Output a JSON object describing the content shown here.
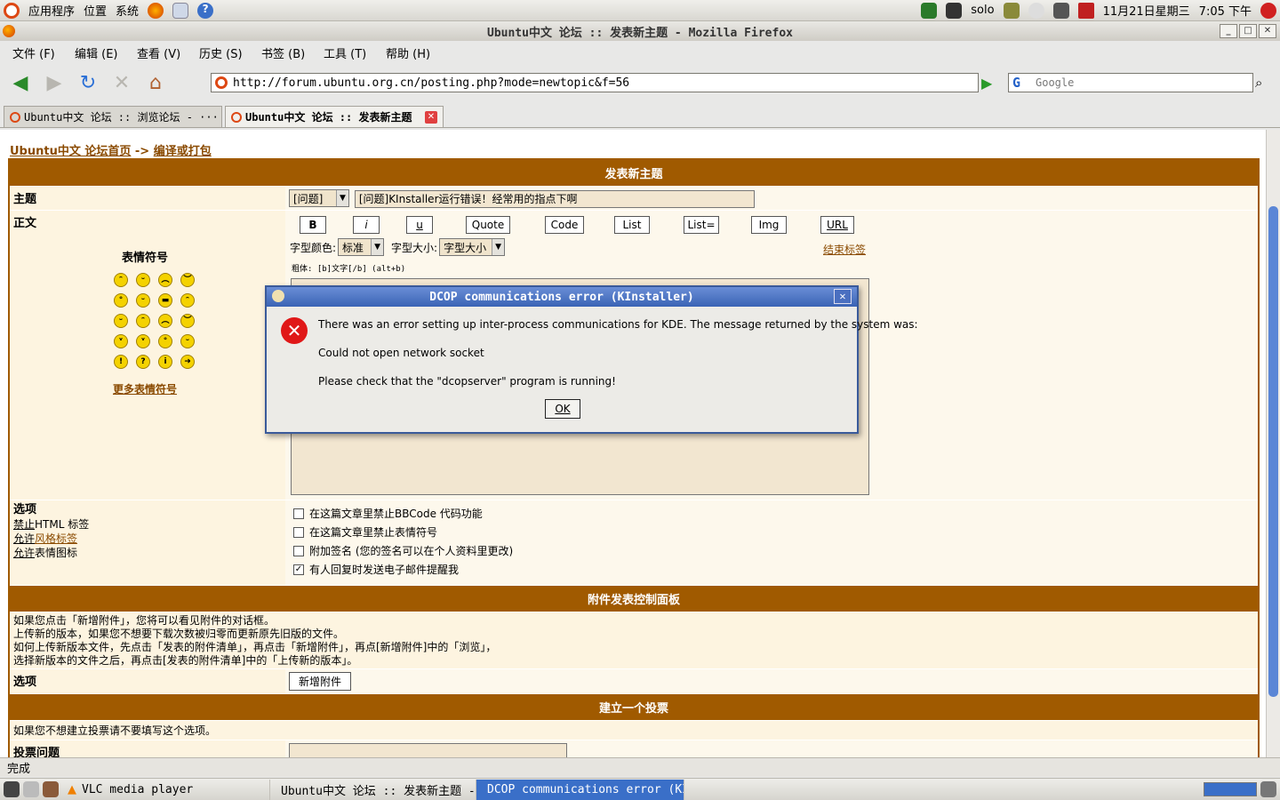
{
  "top_panel": {
    "menus": [
      "应用程序",
      "位置",
      "系统"
    ],
    "user": "solo",
    "date": "11月21日星期三",
    "time": "7:05 下午"
  },
  "window": {
    "title": "Ubuntu中文 论坛 :: 发表新主题 - Mozilla Firefox"
  },
  "menubar": [
    "文件 (F)",
    "编辑 (E)",
    "查看 (V)",
    "历史 (S)",
    "书签 (B)",
    "工具 (T)",
    "帮助 (H)"
  ],
  "navbar": {
    "url": "http://forum.ubuntu.org.cn/posting.php?mode=newtopic&f=56",
    "search_placeholder": "Google"
  },
  "tabs": [
    {
      "label": "Ubuntu中文 论坛 :: 浏览论坛 - ···"
    },
    {
      "label": "Ubuntu中文 论坛 :: 发表新主题"
    }
  ],
  "page": {
    "breadcrumb_home": "Ubuntu中文 论坛首页",
    "breadcrumb_sep": " -> ",
    "breadcrumb_forum": "编译或打包",
    "header_new_topic": "发表新主题",
    "subject_label": "主题",
    "subject_type": "[问题]",
    "subject_value": "[问题]KInstaller运行错误！经常用的指点下啊",
    "body_label": "正文",
    "smilies_title": "表情符号",
    "more_smilies": "更多表情符号",
    "bbcode_buttons": [
      "B",
      "i",
      "u",
      "Quote",
      "Code",
      "List",
      "List=",
      "Img",
      "URL"
    ],
    "font_color_label": "字型颜色:",
    "font_color_value": "标准",
    "font_size_label": "字型大小:",
    "font_size_value": "字型大小",
    "close_tags": "结束标签",
    "bold_hint": "粗体: [b]文字[/b]  (alt+b)",
    "options_label": "选项",
    "html_status_pre": "禁止",
    "html_status_post": "HTML 标签",
    "bbcode_status_pre": "允许",
    "bbcode_status_link": "风格标签",
    "smilies_status_pre": "允许",
    "smilies_status_post": "表情图标",
    "opt_disable_bbcode": "在这篇文章里禁止BBCode 代码功能",
    "opt_disable_smilies": "在这篇文章里禁止表情符号",
    "opt_attach_sig": "附加签名 (您的签名可以在个人资料里更改)",
    "opt_notify": "有人回复时发送电子邮件提醒我",
    "attach_header": "附件发表控制面板",
    "attach_text": [
      "如果您点击「新增附件」，您将可以看见附件的对话框。",
      "上传新的版本，如果您不想要下载次数被归零而更新原先旧版的文件。",
      "如何上传新版本文件，先点击「发表的附件清单」，再点击「新增附件」，再点[新增附件]中的「浏览」，",
      "选择新版本的文件之后，再点击[发表的附件清单]中的「上传新的版本」。"
    ],
    "attach_options_label": "选项",
    "attach_button": "新增附件",
    "poll_header": "建立一个投票",
    "poll_hint": "如果您不想建立投票请不要填写这个选项。",
    "poll_question": "投票问题"
  },
  "dialog": {
    "title": "DCOP communications error (KInstaller)",
    "line1": "There was an error setting up inter-process communications for KDE. The message returned by the system was:",
    "line2": "Could not open network socket",
    "line3": "Please check that the \"dcopserver\" program is running!",
    "ok": "OK",
    "close": "✕"
  },
  "statusbar": {
    "text": "完成"
  },
  "taskbar": {
    "tasks": [
      "VLC media player",
      "Ubuntu中文 论坛 :: 发表新主题 - ···",
      "DCOP communications error (KIn···"
    ]
  }
}
